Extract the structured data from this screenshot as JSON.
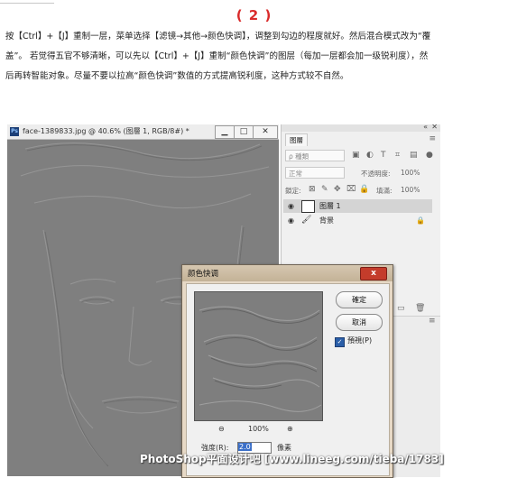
{
  "step_number": "( 2 )",
  "instructions": {
    "line1": "按【Ctrl】+【J】重制一层，菜单选择【滤镜→其他→颜色快调】，调整到勾边的程度就好。然后混合模式改为“覆",
    "line2": "盖”。     若觉得五官不够清晰，可以先以【Ctrl】+【J】重制“颜色快调”的图层（每加一层都会加一级锐利度），然",
    "line3": "后再转智能对象。尽量不要以拉高“颜色快调”数值的方式提高锐利度，这种方式较不自然。"
  },
  "document_window": {
    "badge": "Ps",
    "title": "face-1389833.jpg @ 40.6% (图層 1, RGB/8#) *",
    "minimize": "▁",
    "restore": "□",
    "close": "✕"
  },
  "layers_panel": {
    "collapse": "«",
    "close": "✕",
    "tab": "图層",
    "filter_placeholder": "ρ 種類",
    "blend_mode": "正常",
    "opacity_label": "不透明度:",
    "opacity_value": "100%",
    "lock_label": "鎖定:",
    "fill_label": "填滿:",
    "fill_value": "100%",
    "layers": [
      {
        "name": "图層 1",
        "active": true
      },
      {
        "name": "背景",
        "active": false
      }
    ]
  },
  "dialog": {
    "title": "颜色快调",
    "close": "x",
    "ok_label": "確定",
    "cancel_label": "取消",
    "preview_label": "預視(P)",
    "preview_checked": true,
    "zoom_out": "⊖",
    "zoom_level": "100%",
    "zoom_in": "⊕",
    "radius_label": "強度(R):",
    "radius_value": "2.0",
    "radius_unit": "像素"
  },
  "watermark": "PhotoShop平面设计吧 [www.lineeg.com/tieba/1783]"
}
